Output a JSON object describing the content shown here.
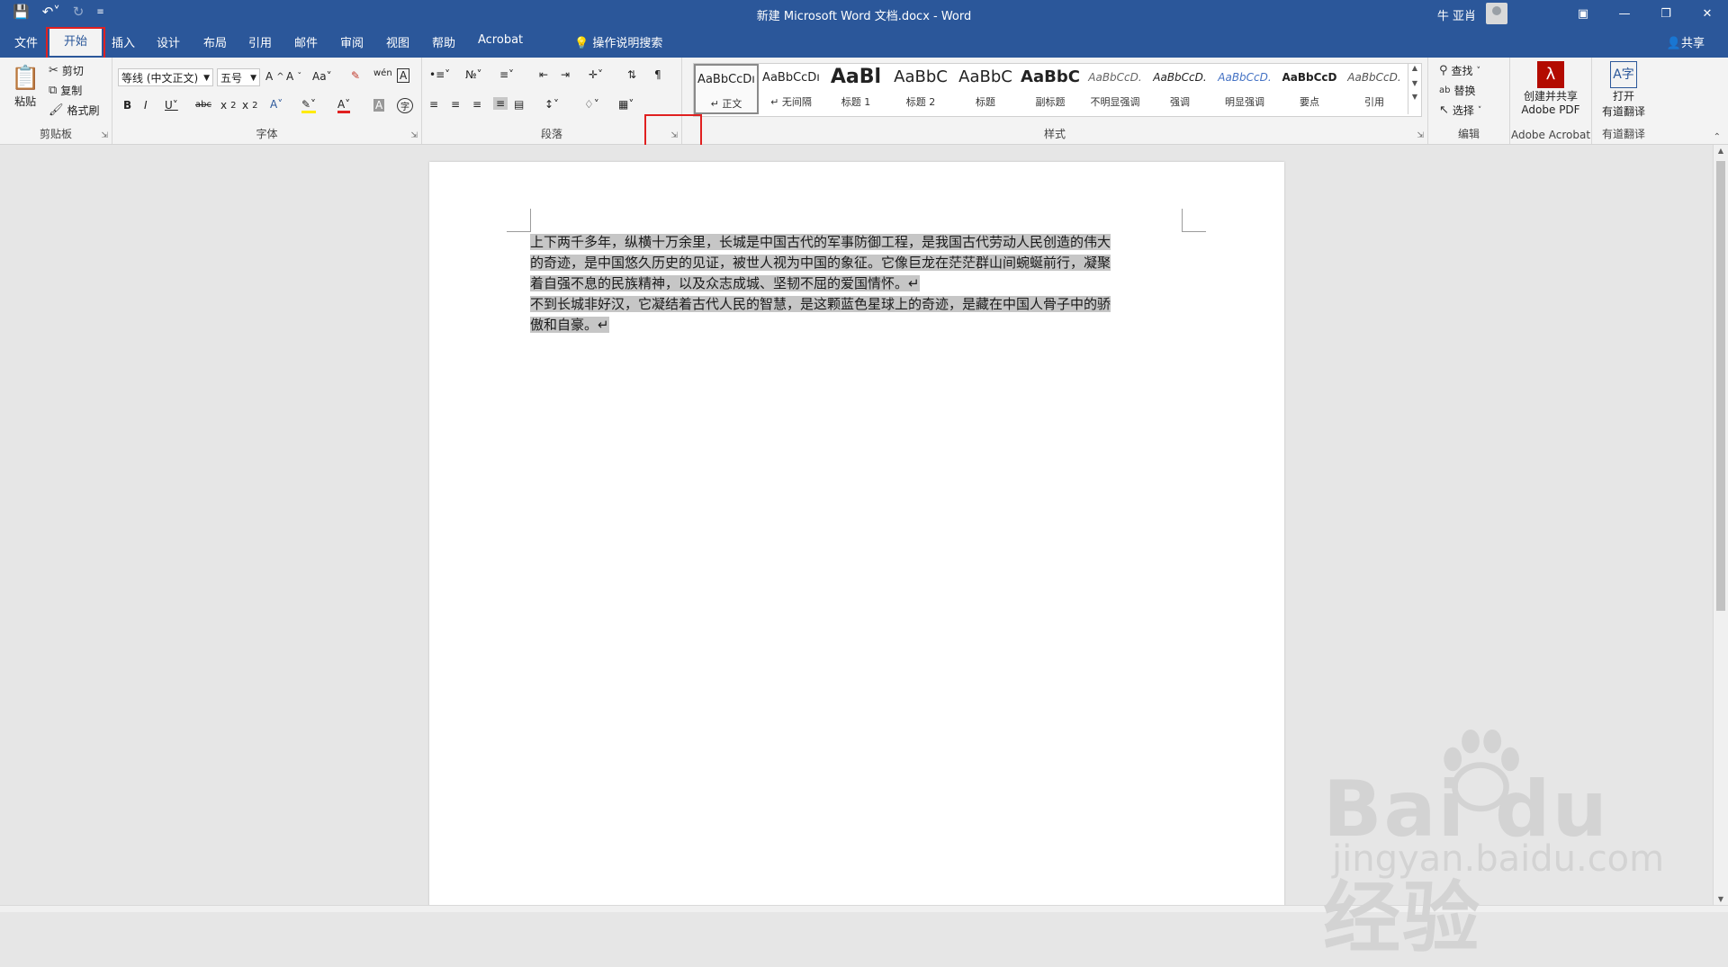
{
  "titlebar": {
    "title": "新建 Microsoft Word 文档.docx  -  Word",
    "user": "牛 亚肖",
    "qat": [
      "save-icon",
      "undo-icon",
      "redo-icon",
      "customize-icon"
    ],
    "window_buttons": [
      "ribbon-display-icon",
      "minimize-icon",
      "restore-icon",
      "close-icon"
    ]
  },
  "tabs": [
    {
      "label": "文件"
    },
    {
      "label": "开始"
    },
    {
      "label": "插入"
    },
    {
      "label": "设计"
    },
    {
      "label": "布局"
    },
    {
      "label": "引用"
    },
    {
      "label": "邮件"
    },
    {
      "label": "审阅"
    },
    {
      "label": "视图"
    },
    {
      "label": "帮助"
    },
    {
      "label": "Acrobat"
    }
  ],
  "tellme": "操作说明搜索",
  "share": "共享",
  "clipboard": {
    "paste": "粘贴",
    "cut": "剪切",
    "copy": "复制",
    "format_painter": "格式刷",
    "label": "剪贴板"
  },
  "font": {
    "name": "等线 (中文正文)",
    "size": "五号",
    "label": "字体"
  },
  "paragraph": {
    "label": "段落"
  },
  "styles": {
    "label": "样式",
    "items": [
      {
        "sample": "AaBbCcDı",
        "name": "↵ 正文"
      },
      {
        "sample": "AaBbCcDı",
        "name": "↵ 无间隔"
      },
      {
        "sample": "AaBl",
        "name": "标题 1"
      },
      {
        "sample": "AaBbC",
        "name": "标题 2"
      },
      {
        "sample": "AaBbC",
        "name": "标题"
      },
      {
        "sample": "AaBbC",
        "name": "副标题"
      },
      {
        "sample": "AaBbCcD.",
        "name": "不明显强调"
      },
      {
        "sample": "AaBbCcD.",
        "name": "强调"
      },
      {
        "sample": "AaBbCcD.",
        "name": "明显强调"
      },
      {
        "sample": "AaBbCcD",
        "name": "要点"
      },
      {
        "sample": "AaBbCcD.",
        "name": "引用"
      }
    ]
  },
  "editing": {
    "find": "查找",
    "replace": "替换",
    "select": "选择",
    "label": "编辑"
  },
  "acrobat": {
    "create_line1": "创建并共享",
    "create_line2": "Adobe PDF",
    "label": "Adobe Acrobat"
  },
  "translate": {
    "open_line1": "打开",
    "open_line2": "有道翻译",
    "label": "有道翻译"
  },
  "document": {
    "p1_l1": "上下两千多年，纵横十万余里，长城是中国古代的军事防御工程，是我国古代劳动人民创造的伟大",
    "p1_l2": "的奇迹，是中国悠久历史的见证，被世人视为中国的象征。它像巨龙在茫茫群山间蜿蜒前行，凝聚",
    "p1_l3": "着自强不息的民族精神，以及众志成城、坚韧不屈的爱国情怀。↵",
    "p2_l1": "不到长城非好汉，它凝结着古代人民的智慧，是这颗蓝色星球上的奇迹，是藏在中国人骨子中的骄",
    "p2_l2": "傲和自豪。↵"
  },
  "watermark": {
    "line1": "Bai du 经验",
    "line2": "jingyan.baidu.com"
  },
  "colors": {
    "brand": "#2b579a",
    "highlight": "#e02020",
    "selection": "#c6c6c6"
  }
}
